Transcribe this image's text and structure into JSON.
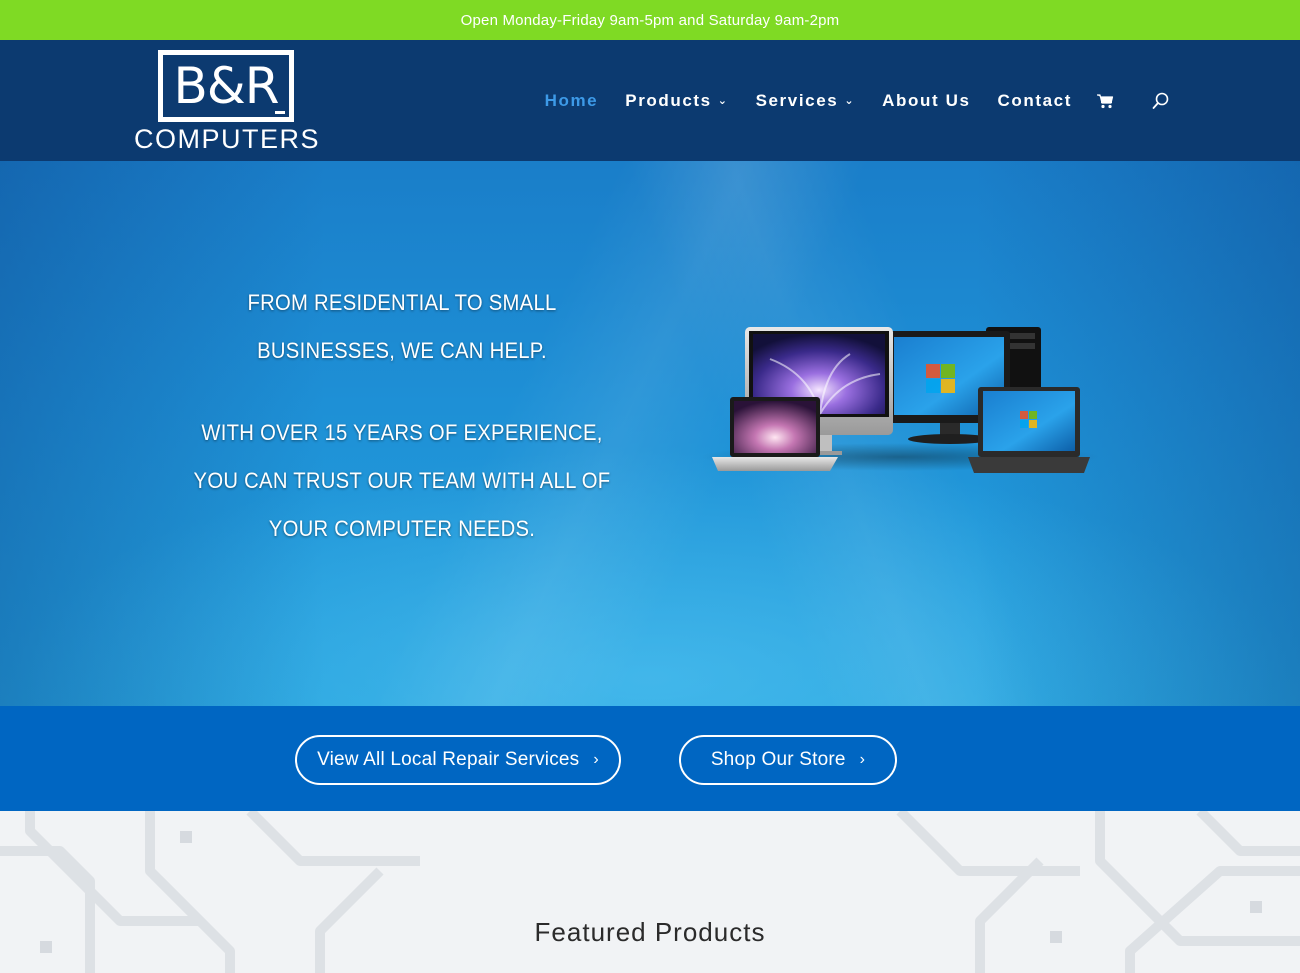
{
  "topbar": {
    "hours": "Open Monday-Friday 9am-5pm and Saturday 9am-2pm"
  },
  "logo": {
    "main": "B&R",
    "sub": "COMPUTERS"
  },
  "nav": {
    "items": [
      {
        "label": "Home",
        "active": true,
        "dropdown": false
      },
      {
        "label": "Products",
        "active": false,
        "dropdown": true
      },
      {
        "label": "Services",
        "active": false,
        "dropdown": true
      },
      {
        "label": "About Us",
        "active": false,
        "dropdown": false
      },
      {
        "label": "Contact",
        "active": false,
        "dropdown": false
      }
    ],
    "icons": [
      "cart-icon",
      "search-icon"
    ]
  },
  "hero": {
    "line1": "FROM RESIDENTIAL TO SMALL BUSINESSES, WE CAN HELP.",
    "line2": "WITH OVER 15 YEARS OF EXPERIENCE, YOU CAN TRUST OUR TEAM WITH ALL OF YOUR COMPUTER NEEDS."
  },
  "cta": {
    "services_label": "View All Local Repair Services",
    "store_label": "Shop Our Store"
  },
  "featured": {
    "title": "Featured Products"
  },
  "colors": {
    "topbar": "#7fda24",
    "header": "#0c3a70",
    "nav_active": "#3d9ae8",
    "cta_band": "#0066c2",
    "hero": "#1e90d6"
  }
}
